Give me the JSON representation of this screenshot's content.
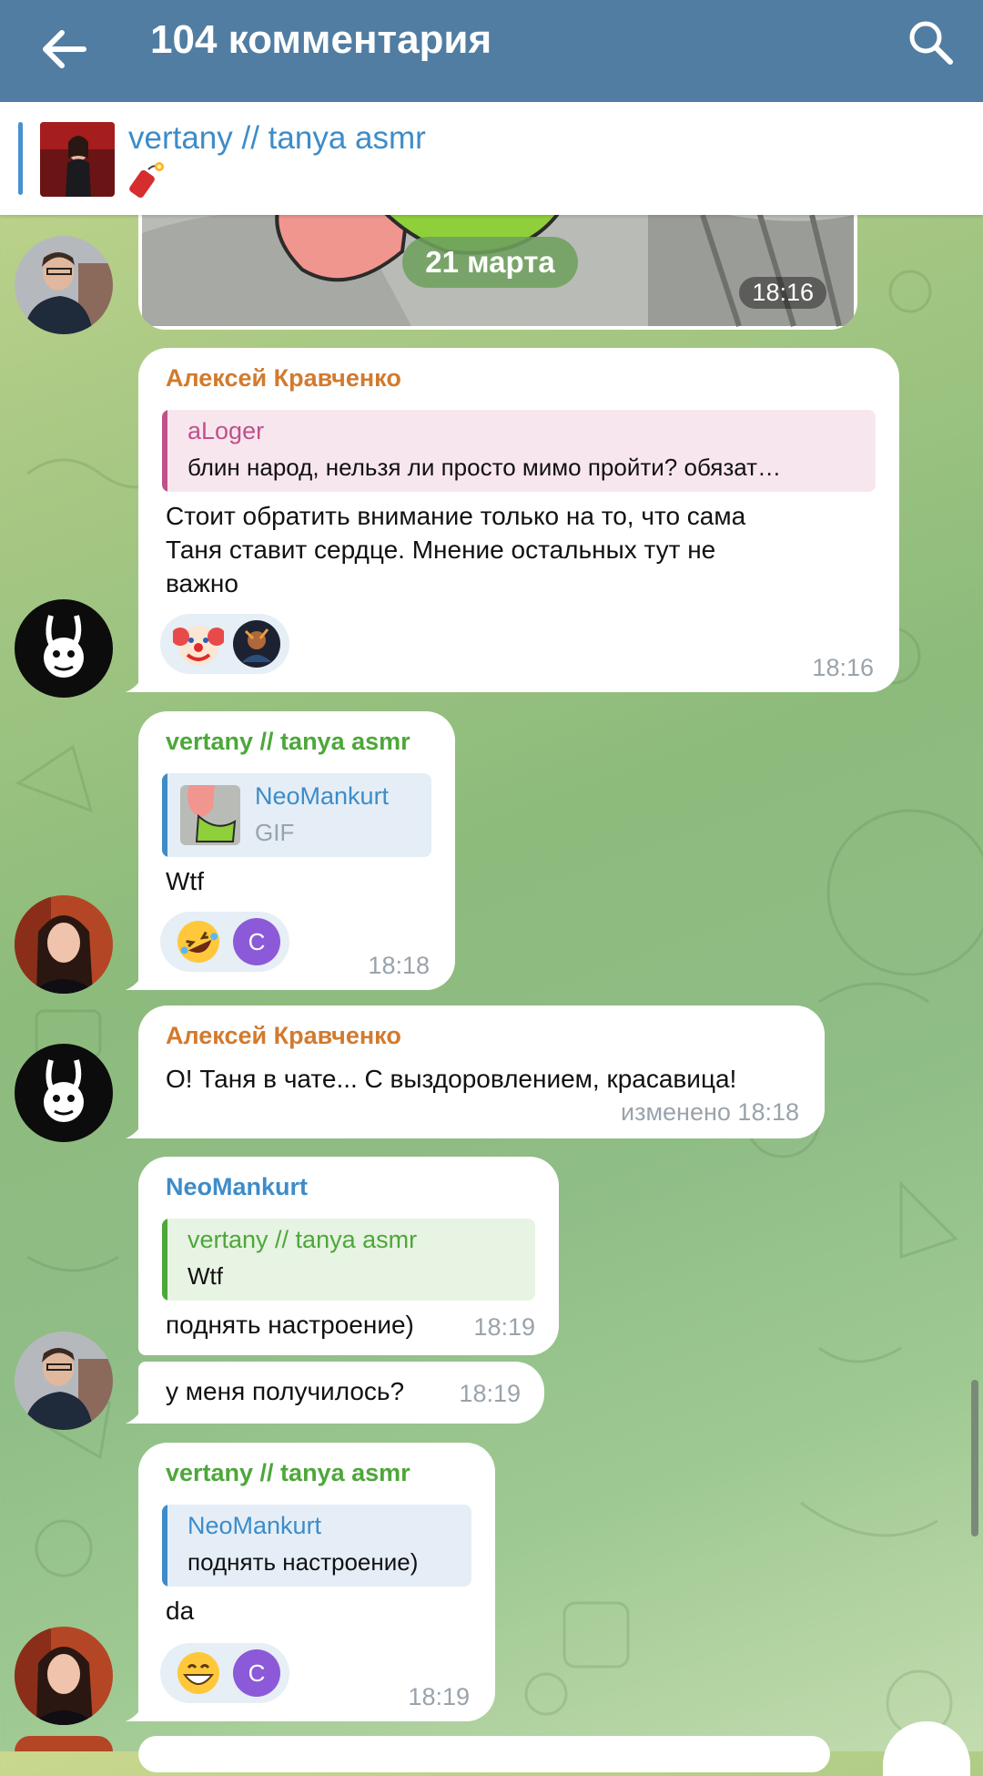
{
  "header": {
    "title": "104 комментария",
    "back_icon": "arrow-left-icon",
    "search_icon": "search-icon",
    "bg_color": "#517da2"
  },
  "pinned": {
    "channel_name": "vertany // tanya asmr",
    "emoji_icon": "dynamite-icon"
  },
  "date_divider": "21 марта",
  "messages": [
    {
      "id": "m0",
      "type": "gif-partial",
      "time": "18:16"
    },
    {
      "id": "m1",
      "sender": "Алексей Кравченко",
      "sender_color": "#d27a2e",
      "reply": {
        "name": "aLoger",
        "text": "блин народ, нельзя ли просто мимо пройти? обязат…",
        "color": "#c0508a"
      },
      "text_lines": [
        "Стоит обратить внимание только на то, что сама",
        "Таня ставит сердце. Мнение остальных тут не",
        "важно"
      ],
      "reactions": [
        "clown-face-icon",
        "user-avatar"
      ],
      "time": "18:16"
    },
    {
      "id": "m2",
      "sender": "vertany // tanya asmr",
      "sender_color": "#4da73a",
      "reply": {
        "name": "NeoMankurt",
        "text": "GIF",
        "color": "#3d8cc9"
      },
      "text": "Wtf",
      "reactions": [
        "rolling-laughing-icon",
        "C"
      ],
      "time": "18:18"
    },
    {
      "id": "m3",
      "sender": "Алексей Кравченко",
      "sender_color": "#d27a2e",
      "text": "О! Таня в чате... С выздоровлением, красавица!",
      "edited_label": "изменено",
      "time": "18:18"
    },
    {
      "id": "m4",
      "sender": "NeoMankurt",
      "sender_color": "#3d8cc9",
      "reply": {
        "name": "vertany // tanya asmr",
        "text": "Wtf",
        "color": "#4da73a"
      },
      "text": "поднять настроение)",
      "time": "18:19"
    },
    {
      "id": "m5",
      "text": "у меня получилось?",
      "time": "18:19"
    },
    {
      "id": "m6",
      "sender": "vertany // tanya asmr",
      "sender_color": "#4da73a",
      "reply": {
        "name": "NeoMankurt",
        "text": "поднять настроение)",
        "color": "#3d8cc9"
      },
      "text": "da",
      "reactions": [
        "grinning-face-icon",
        "C"
      ],
      "time": "18:19"
    }
  ]
}
